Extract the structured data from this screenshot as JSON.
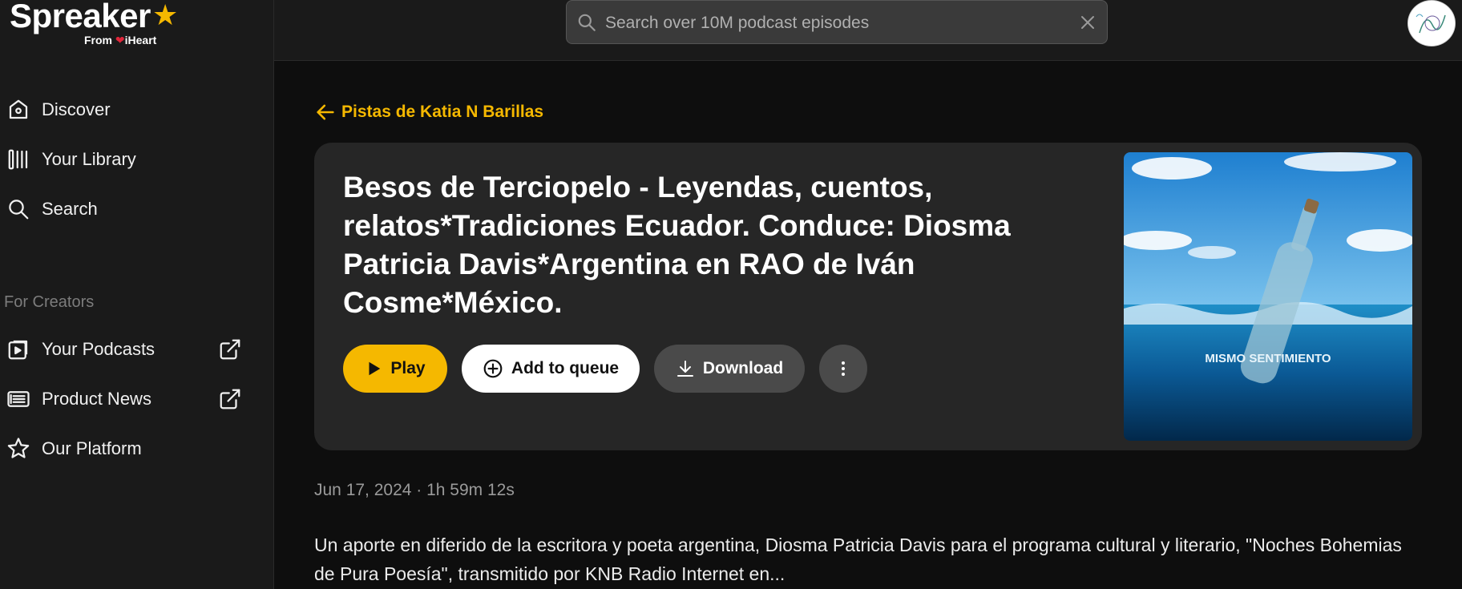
{
  "brand": {
    "name": "Spreaker",
    "from_label": "From",
    "iheart_label": "iHeart",
    "accent_color": "#f5b800"
  },
  "sidebar": {
    "items": [
      {
        "label": "Discover",
        "icon": "home-icon"
      },
      {
        "label": "Your Library",
        "icon": "library-icon"
      },
      {
        "label": "Search",
        "icon": "search-icon"
      }
    ],
    "creators_section_label": "For Creators",
    "creator_items": [
      {
        "label": "Your Podcasts",
        "icon": "podcast-icon",
        "external": true
      },
      {
        "label": "Product News",
        "icon": "news-icon",
        "external": true
      },
      {
        "label": "Our Platform",
        "icon": "star-icon",
        "external": false
      }
    ]
  },
  "search": {
    "placeholder": "Search over 10M podcast episodes",
    "value": ""
  },
  "episode": {
    "back_label": "Pistas de Katia N Barillas",
    "title": "Besos de Terciopelo - Leyendas, cuentos, relatos*Tradiciones Ecuador. Conduce: Diosma Patricia Davis*Argentina en RAO de Iván Cosme*México.",
    "cover_text": "MISMO SENTIMIENTO",
    "meta": "Jun 17, 2024 · 1h 59m 12s",
    "description": "Un aporte en diferido de la escritora y poeta argentina, Diosma Patricia Davis para el programa cultural y literario, \"Noches Bohemias de Pura Poesía\", transmitido por KNB Radio Internet en..."
  },
  "actions": {
    "play_label": "Play",
    "queue_label": "Add to queue",
    "download_label": "Download"
  }
}
